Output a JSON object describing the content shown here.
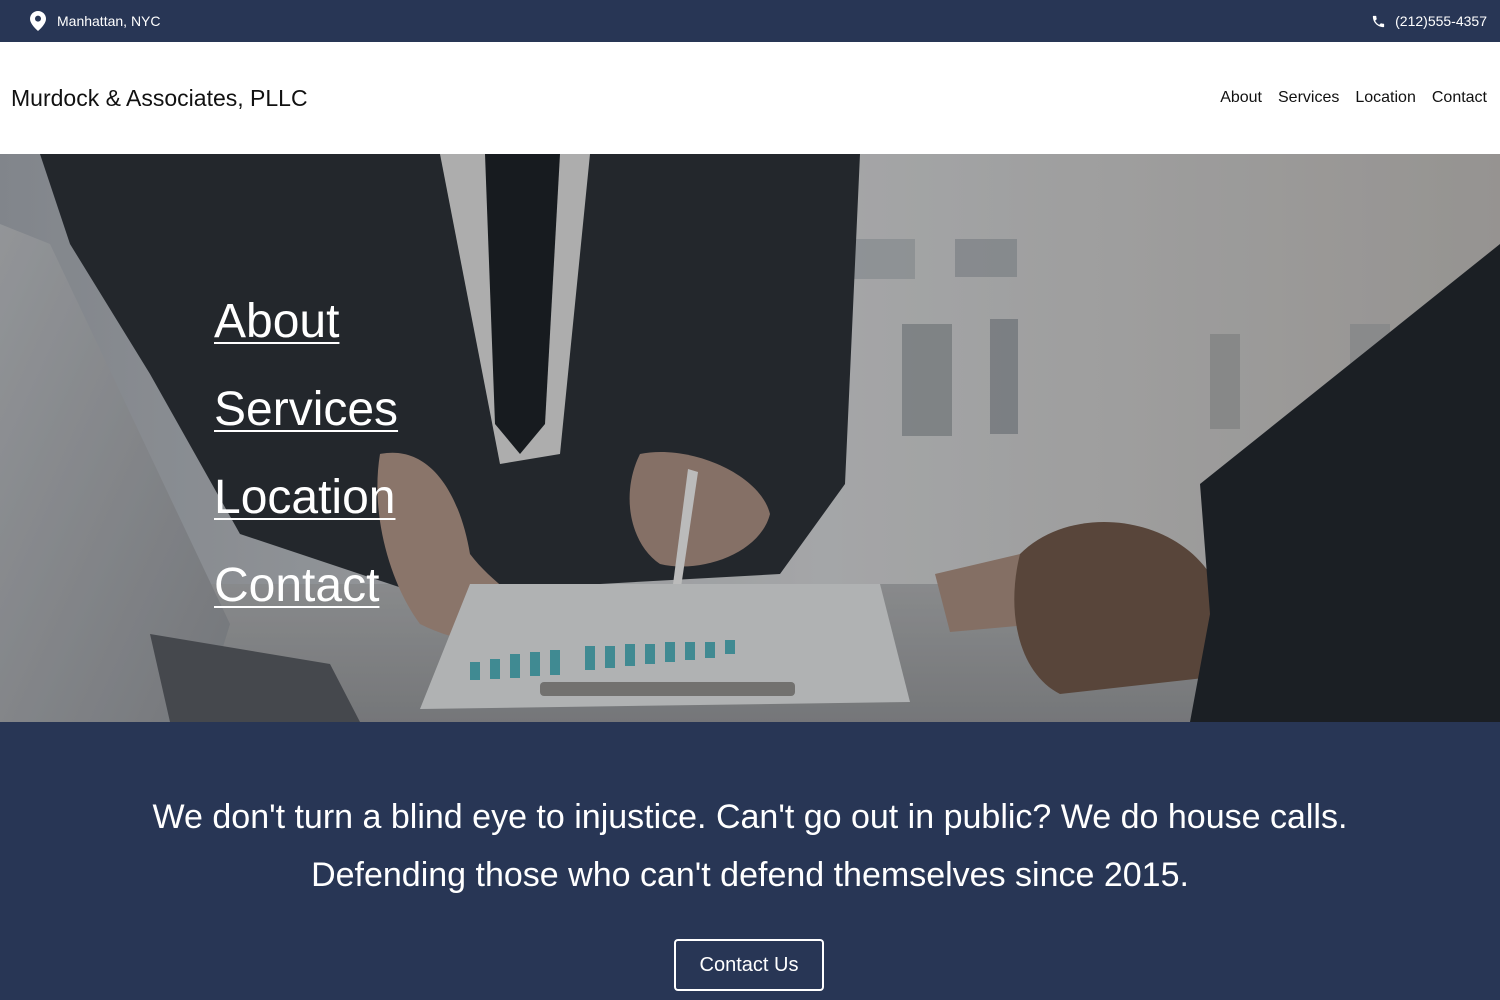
{
  "topbar": {
    "location": "Manhattan, NYC",
    "location_icon": "map-pin-icon",
    "phone": "(212)555-4357",
    "phone_icon": "phone-icon",
    "background": "#283655"
  },
  "header": {
    "brand": "Murdock & Associates, PLLC",
    "nav": [
      {
        "label": "About"
      },
      {
        "label": "Services"
      },
      {
        "label": "Location"
      },
      {
        "label": "Contact"
      }
    ]
  },
  "hero": {
    "links": [
      {
        "label": "About"
      },
      {
        "label": "Services"
      },
      {
        "label": "Location"
      },
      {
        "label": "Contact"
      }
    ]
  },
  "tagline": {
    "line1": "We don't turn a blind eye to injustice. Can't go out in public? We do house calls.",
    "line2": "Defending those who can't defend themselves since 2015.",
    "cta_label": "Contact Us",
    "background": "#283655"
  }
}
